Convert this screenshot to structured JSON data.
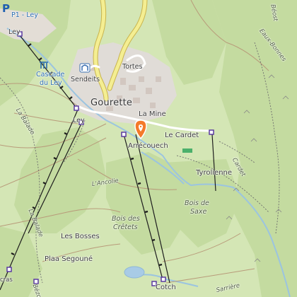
{
  "map": {
    "labels": {
      "gourette": "Gourette",
      "tortes": "Tortes",
      "sendeits": "Sendeits",
      "cascade_1": "Cascade",
      "cascade_2": "du Ley",
      "p1_ley": "P1 - Ley",
      "ley_top": "Ley",
      "ley_mid": "Ley",
      "la_mine": "La Mine",
      "le_cardet": "Le Cardet",
      "arrecouech": "Arrécouech",
      "tyrolienne": "Tyrolienne",
      "bois_de_saxe_1": "Bois de",
      "bois_de_saxe_2": "Saxe",
      "bois_cretets_1": "Bois des",
      "bois_cretets_2": "Crêtets",
      "les_bosses": "Les Bosses",
      "plaa_segoune": "Plaa Segouné",
      "cotch": "Cotch",
      "la_balade": "La Balade",
      "la_balade_2": "La Balade",
      "l_ancolie": "L'Ancolie",
      "cardet_slope": "Cardet",
      "sarriere": "Sarrière",
      "eaux_bonnes": "Eaux-Bonnes",
      "beost": "Béost",
      "cras": "cras",
      "bezou": "Bézou"
    },
    "colors": {
      "forest": "#c4dba0",
      "meadow": "#d4e6b5",
      "urban": "#e0dcd7",
      "road_major": "#f4ee92",
      "river": "#9bc4e0",
      "aerialway": "#222222",
      "marker": "#f47a2a"
    },
    "icons": [
      "parking-icon",
      "waterfall-icon",
      "location-pin-icon",
      "lift-station-icon",
      "marker-icon"
    ]
  }
}
